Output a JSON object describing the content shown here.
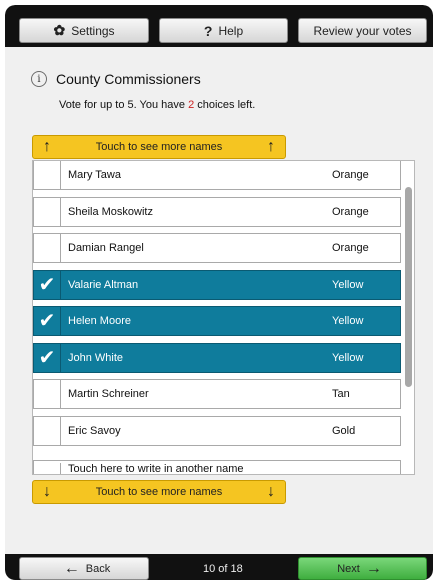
{
  "toolbar": {
    "settings_label": "Settings",
    "help_label": "Help",
    "review_label": "Review your votes"
  },
  "contest": {
    "title": "County Commissioners",
    "instructions_prefix": "Vote for up to 5. You have ",
    "choices_left": "2",
    "instructions_suffix": " choices left."
  },
  "scroll": {
    "up_label": "Touch to see more names",
    "down_label": "Touch to see more names"
  },
  "candidates": [
    {
      "name": "Mary Tawa",
      "party": "Orange",
      "selected": false
    },
    {
      "name": "Sheila Moskowitz",
      "party": "Orange",
      "selected": false
    },
    {
      "name": "Damian Rangel",
      "party": "Orange",
      "selected": false
    },
    {
      "name": "Valarie Altman",
      "party": "Yellow",
      "selected": true
    },
    {
      "name": "Helen Moore",
      "party": "Yellow",
      "selected": true
    },
    {
      "name": "John White",
      "party": "Yellow",
      "selected": true
    },
    {
      "name": "Martin Schreiner",
      "party": "Tan",
      "selected": false
    },
    {
      "name": "Eric Savoy",
      "party": "Gold",
      "selected": false
    },
    {
      "name": "Touch here to write in another name",
      "party": "",
      "selected": false
    }
  ],
  "footer": {
    "back_label": "Back",
    "page_indicator": "10 of 18",
    "next_label": "Next"
  },
  "icons": {
    "settings": "gear-icon",
    "help": "question-mark-icon",
    "info": "info-icon",
    "up": "arrow-up-icon",
    "down": "arrow-down-icon",
    "check": "checkmark-icon"
  },
  "colors": {
    "selected_row": "#0f7c9c",
    "scroll_button": "#f5c521",
    "next_button": "#4cbb4c",
    "choices_left": "#cc2222"
  }
}
